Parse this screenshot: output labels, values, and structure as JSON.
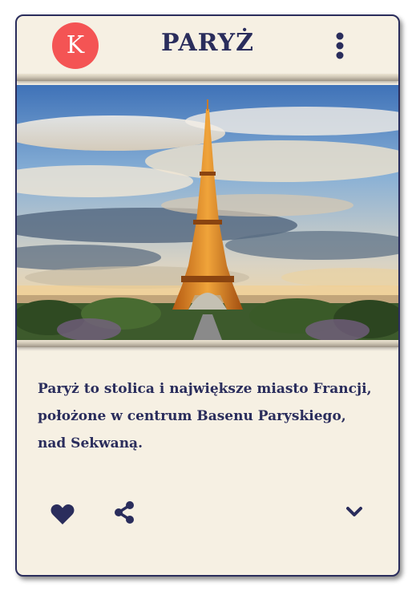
{
  "card": {
    "avatar_letter": "K",
    "title": "PARYŻ",
    "image_alt": "Eiffel Tower in Paris at sunset",
    "description": "Paryż to stolica i największe miasto Francji, położone w centrum Basenu Paryskiego, nad Sekwaną.",
    "actions": {
      "like_icon": "heart-icon",
      "share_icon": "share-icon",
      "expand_icon": "chevron-down-icon",
      "menu_icon": "more-vertical-icon"
    }
  },
  "colors": {
    "card_bg": "#f6f0e3",
    "text": "#2a2d5c",
    "avatar_bg": "#f45454"
  }
}
